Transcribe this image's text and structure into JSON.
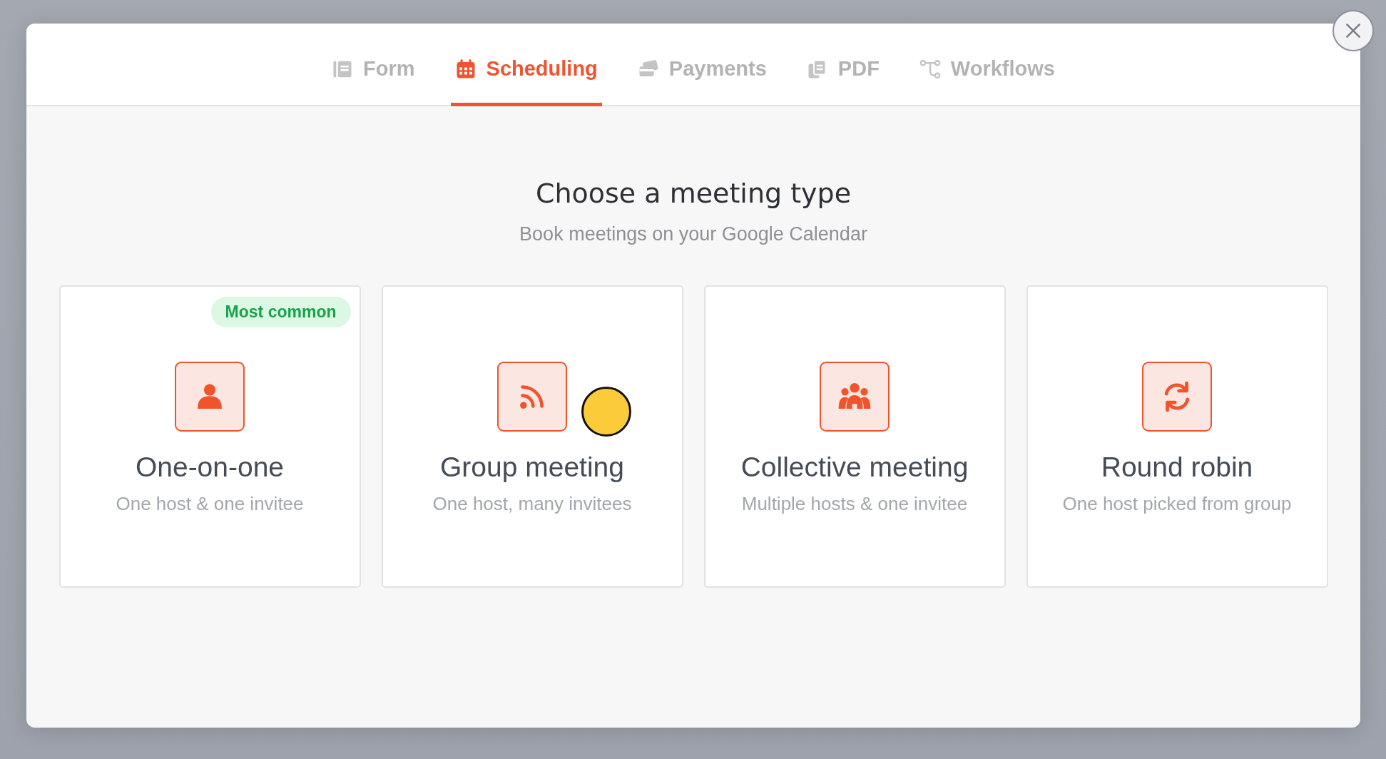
{
  "tabs": [
    {
      "label": "Form",
      "selected": false
    },
    {
      "label": "Scheduling",
      "selected": true
    },
    {
      "label": "Payments",
      "selected": false
    },
    {
      "label": "PDF",
      "selected": false
    },
    {
      "label": "Workflows",
      "selected": false
    }
  ],
  "heading": "Choose a meeting type",
  "subheading": "Book meetings on your Google Calendar",
  "meeting_types": [
    {
      "title": "One-on-one",
      "description": "One host & one invitee",
      "badge": "Most common"
    },
    {
      "title": "Group meeting",
      "description": "One host, many invitees"
    },
    {
      "title": "Collective meeting",
      "description": "Multiple hosts & one invitee"
    },
    {
      "title": "Round robin",
      "description": "One host picked from group"
    }
  ]
}
